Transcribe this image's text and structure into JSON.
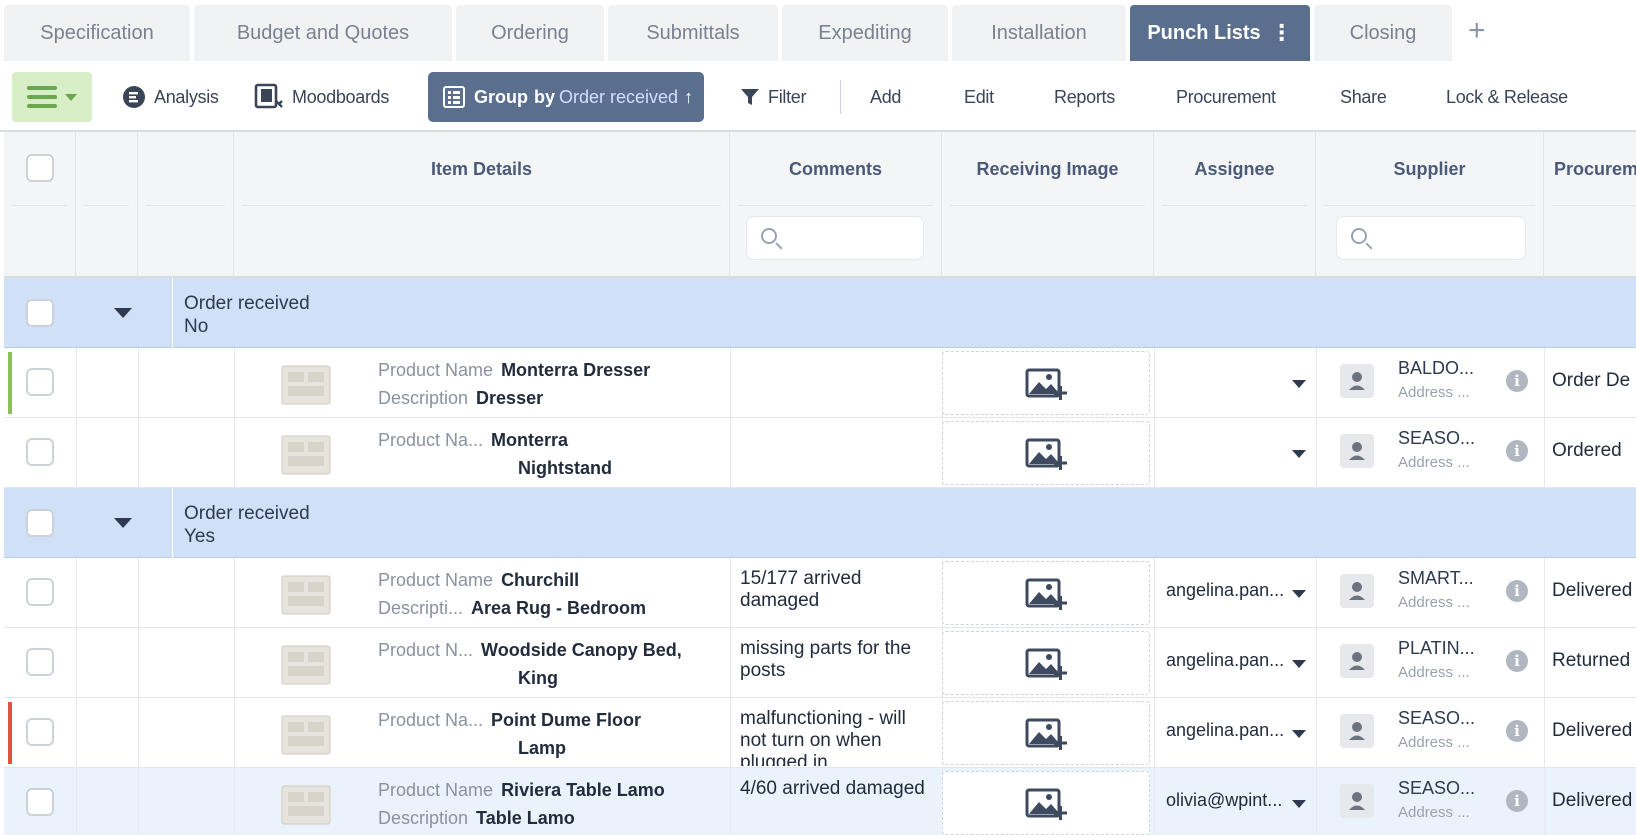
{
  "tabs": [
    {
      "label": "Specification"
    },
    {
      "label": "Budget and Quotes"
    },
    {
      "label": "Ordering"
    },
    {
      "label": "Submittals"
    },
    {
      "label": "Expediting"
    },
    {
      "label": "Installation"
    },
    {
      "label": "Punch Lists",
      "active": true
    },
    {
      "label": "Closing"
    }
  ],
  "tab_menu": "⋮",
  "tab_add": "+",
  "toolbar": {
    "analysis": "Analysis",
    "moodboards": "Moodboards",
    "group_prefix": "Group",
    "group_by": "by",
    "group_value": "Order received",
    "group_sort": "↑",
    "filter": "Filter",
    "add": "Add",
    "edit": "Edit",
    "reports": "Reports",
    "procurement": "Procurement",
    "share": "Share",
    "lock_release": "Lock & Release"
  },
  "columns": {
    "item_details": "Item Details",
    "comments": "Comments",
    "receiving_image": "Receiving Image",
    "assignee": "Assignee",
    "supplier": "Supplier",
    "procurement": "Procurem"
  },
  "groups": [
    {
      "title": "Order received",
      "value": "No",
      "rows": [
        {
          "label1": "Product Name",
          "value1": "Monterra Dresser",
          "label2": "Description",
          "value2": "Dresser",
          "comment": "",
          "assignee": "",
          "supplier": "BALDO...",
          "address": "Address ...",
          "procurement": "Order De",
          "flag": "#8cc152"
        },
        {
          "label1": "Product Na...",
          "value1": "Monterra",
          "label2": "",
          "value2": "Nightstand",
          "comment": "",
          "assignee": "",
          "supplier": "SEASO...",
          "address": "Address ...",
          "procurement": "Ordered",
          "flag": ""
        }
      ]
    },
    {
      "title": "Order received",
      "value": "Yes",
      "rows": [
        {
          "label1": "Product Name",
          "value1": "Churchill",
          "label2": "Descripti...",
          "value2": "Area Rug - Bedroom",
          "comment": "15/177 arrived damaged",
          "assignee": "angelina.pan...",
          "supplier": "SMART...",
          "address": "Address ...",
          "procurement": "Delivered",
          "flag": ""
        },
        {
          "label1": "Product N...",
          "value1": "Woodside Canopy Bed,",
          "label2": "",
          "value2": "King",
          "comment": "missing parts for the posts",
          "assignee": "angelina.pan...",
          "supplier": "PLATIN...",
          "address": "Address ...",
          "procurement": "Returned",
          "flag": ""
        },
        {
          "label1": "Product Na...",
          "value1": "Point Dume Floor",
          "label2": "",
          "value2": "Lamp",
          "comment": "malfunctioning - will not turn on when plugged in",
          "assignee": "angelina.pan...",
          "supplier": "SEASO...",
          "address": "Address ...",
          "procurement": "Delivered",
          "flag": "#e0533d"
        },
        {
          "label1": "Product Name",
          "value1": "Riviera Table Lamo",
          "label2": "Description",
          "value2": "Table Lamo",
          "comment": "4/60 arrived damaged",
          "assignee": "olivia@wpint...",
          "supplier": "SEASO...",
          "address": "Address ...",
          "procurement": "Delivered",
          "flag": "",
          "highlighted": true
        }
      ]
    }
  ]
}
